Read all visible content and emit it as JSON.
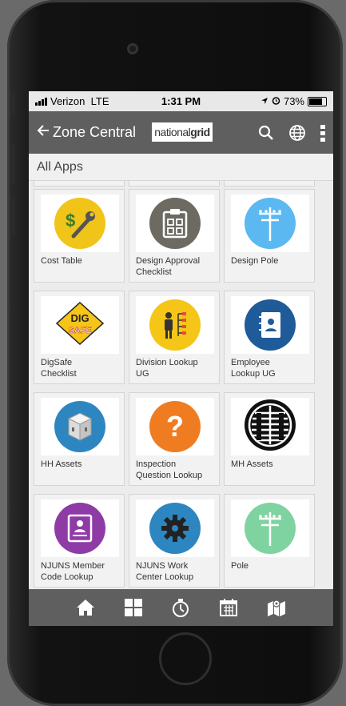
{
  "status_bar": {
    "carrier": "Verizon",
    "network": "LTE",
    "time": "1:31 PM",
    "battery": "73%"
  },
  "header": {
    "back_label": "Zone Central",
    "logo_light": "national",
    "logo_bold": "grid"
  },
  "subheader": {
    "title": "All Apps"
  },
  "apps": [
    {
      "label_line1": "Cost Table",
      "label_line2": "",
      "icon": "wrench-dollar-icon",
      "color": "#f0c419"
    },
    {
      "label_line1": "Design Approval",
      "label_line2": "Checklist",
      "icon": "clipboard-checklist-icon",
      "color": "#6d6a62"
    },
    {
      "label_line1": "Design Pole",
      "label_line2": "",
      "icon": "utility-pole-icon",
      "color": "#5cb8f0"
    },
    {
      "label_line1": "DigSafe",
      "label_line2": "Checklist",
      "icon": "digsafe-logo-icon",
      "color": "#f5c518"
    },
    {
      "label_line1": "Division Lookup",
      "label_line2": "UG",
      "icon": "person-hierarchy-icon",
      "color": "#f5c518"
    },
    {
      "label_line1": "Employee",
      "label_line2": "Lookup UG",
      "icon": "contact-book-icon",
      "color": "#1f5b99"
    },
    {
      "label_line1": "HH Assets",
      "label_line2": "",
      "icon": "handhole-box-icon",
      "color": "#2e86c1"
    },
    {
      "label_line1": "Inspection",
      "label_line2": "Question Lookup",
      "icon": "question-mark-icon",
      "color": "#f07c22"
    },
    {
      "label_line1": "MH Assets",
      "label_line2": "",
      "icon": "manhole-cover-icon",
      "color": "#111111"
    },
    {
      "label_line1": "NJUNS Member",
      "label_line2": "Code Lookup",
      "icon": "id-card-icon",
      "color": "#8e3ba6"
    },
    {
      "label_line1": "NJUNS Work",
      "label_line2": "Center Lookup",
      "icon": "gear-icon",
      "color": "#2e86c1"
    },
    {
      "label_line1": "Pole",
      "label_line2": "",
      "icon": "utility-pole-icon",
      "color": "#7fd3a0"
    }
  ],
  "tabbar": [
    "home-icon",
    "grid-icon",
    "stopwatch-icon",
    "calendar-icon",
    "map-icon"
  ],
  "colors": {
    "header_bg": "#5f5f5f",
    "status_bg": "#e8e8e8",
    "tile_bg": "#f2f2f2"
  }
}
